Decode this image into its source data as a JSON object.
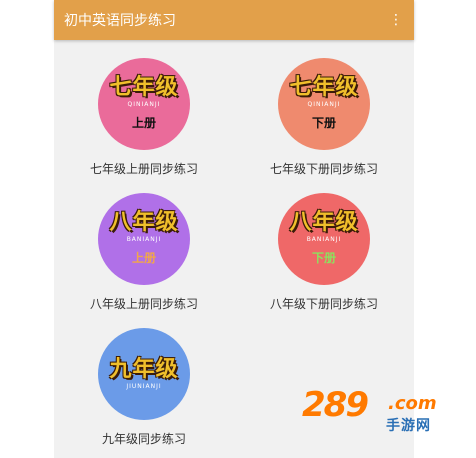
{
  "app": {
    "title": "初中英语同步练习",
    "menu_icon": "more-vert-icon"
  },
  "items": [
    {
      "grade": "七年级",
      "pinyin": "QINIANJI",
      "volume": "上册",
      "caption": "七年级上册同步练习",
      "circle_color": "#ea6b9a"
    },
    {
      "grade": "七年级",
      "pinyin": "QINIANJI",
      "volume": "下册",
      "caption": "七年级下册同步练习",
      "circle_color": "#ef8a6e"
    },
    {
      "grade": "八年级",
      "pinyin": "BANIANJI",
      "volume": "上册",
      "caption": "八年级上册同步练习",
      "circle_color": "#b070e8"
    },
    {
      "grade": "八年级",
      "pinyin": "BANIANJI",
      "volume": "下册",
      "caption": "八年级下册同步练习",
      "circle_color": "#ef6868"
    },
    {
      "grade": "九年级",
      "pinyin": "JIUNIANJI",
      "volume": "",
      "caption": "九年级同步练习",
      "circle_color": "#6b9be8"
    }
  ],
  "watermark": {
    "number": "289",
    "domain": ".com",
    "site": "手游网"
  }
}
